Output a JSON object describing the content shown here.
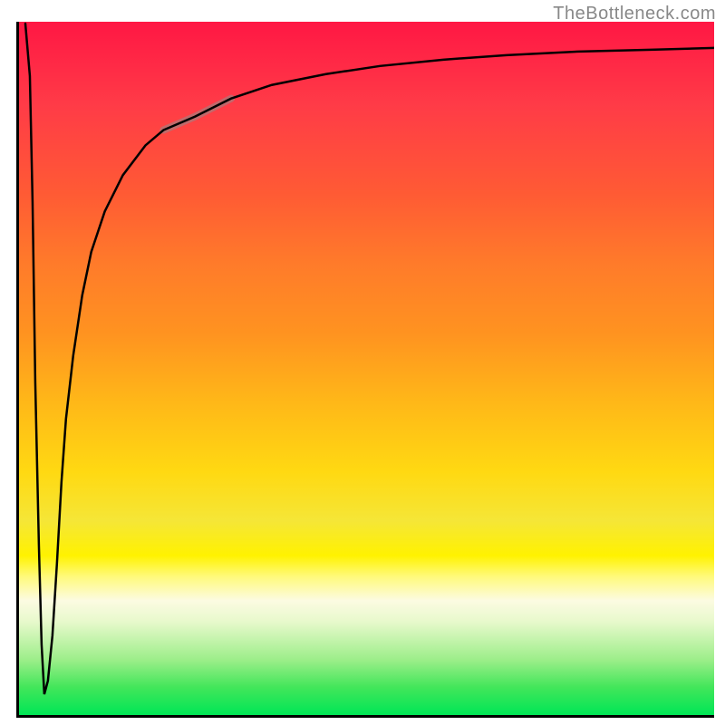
{
  "watermark": "TheBottleneck.com",
  "chart_data": {
    "type": "line",
    "title": "",
    "xlabel": "",
    "ylabel": "",
    "xlim": [
      0,
      100
    ],
    "ylim": [
      0,
      100
    ],
    "grid": false,
    "legend": false,
    "annotations": [],
    "series": [
      {
        "name": "main-curve",
        "x": [
          0,
          2,
          3,
          3.5,
          4,
          5,
          6,
          7,
          8,
          10,
          12,
          15,
          20,
          25,
          30,
          35,
          40,
          50,
          60,
          70,
          80,
          90,
          100
        ],
        "y": [
          100,
          45,
          10,
          5,
          10,
          35,
          50,
          60,
          67,
          73,
          77,
          81,
          85,
          88,
          90,
          91,
          92,
          93.5,
          94.5,
          95,
          95.5,
          96,
          96.3
        ],
        "color": "#000000"
      },
      {
        "name": "highlight-segment",
        "x": [
          20,
          25,
          30
        ],
        "y": [
          85,
          88,
          90
        ],
        "color": "#ab7878"
      }
    ],
    "gradient_stops": [
      {
        "pos": 0,
        "color": "#ff1744"
      },
      {
        "pos": 50,
        "color": "#ffb818"
      },
      {
        "pos": 77,
        "color": "#fff200"
      },
      {
        "pos": 100,
        "color": "#00e656"
      }
    ]
  }
}
